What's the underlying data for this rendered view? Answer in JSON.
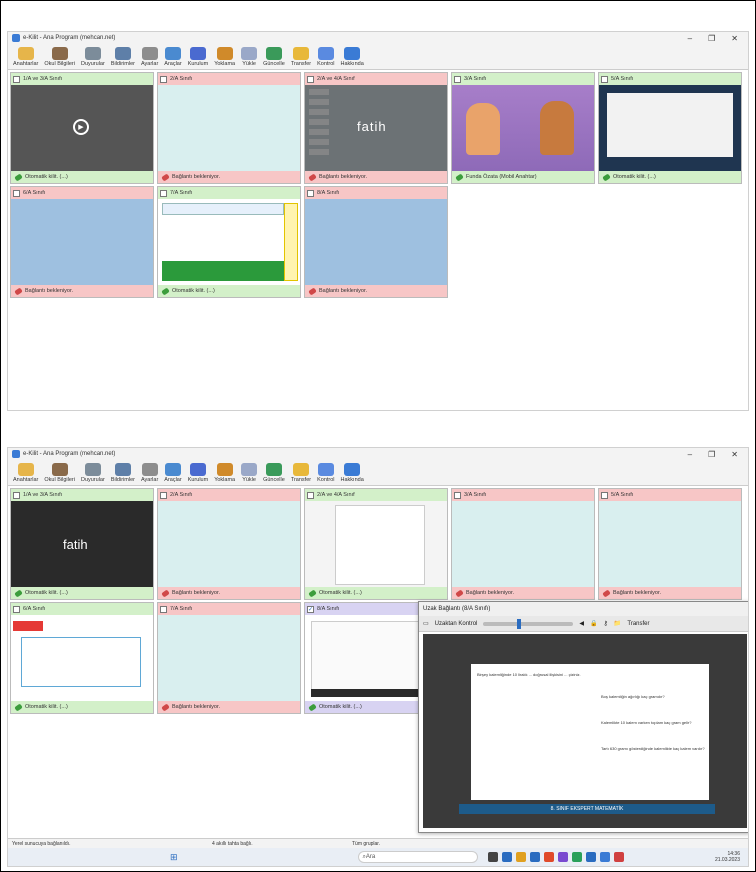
{
  "app": {
    "title": "e-Kilit - Ana Program (mehcan.net)"
  },
  "toolbar": [
    {
      "label": "Anahtarlar",
      "color": "#e6b54a"
    },
    {
      "label": "Okul Bilgileri",
      "color": "#8a6a4a"
    },
    {
      "label": "Duyurular",
      "color": "#7c8c9a"
    },
    {
      "label": "Bildirimler",
      "color": "#5e7fa8"
    },
    {
      "label": "Ayarlar",
      "color": "#8d8d8d"
    },
    {
      "label": "Araçlar",
      "color": "#4a8ad0"
    },
    {
      "label": "Kurulum",
      "color": "#4a6ad0"
    },
    {
      "label": "Yoklama",
      "color": "#d08a2a"
    },
    {
      "label": "Yükle",
      "color": "#9aa8c8"
    },
    {
      "label": "Güncelle",
      "color": "#3a9a5a"
    },
    {
      "label": "Transfer",
      "color": "#e8b83a"
    },
    {
      "label": "Kontrol",
      "color": "#5a8ae0"
    },
    {
      "label": "Hakkında",
      "color": "#3a7bd5"
    }
  ],
  "top": {
    "tiles": [
      {
        "name": "1/A ve 3/A Sınıfı",
        "status": "Otomatik kilit. (...)",
        "state": "green",
        "preview": "video",
        "checked": false
      },
      {
        "name": "2/A Sınıfı",
        "status": "Bağlantı bekleniyor.",
        "state": "red",
        "preview": "empty",
        "checked": false
      },
      {
        "name": "2/A ve 4/A Sınıf",
        "status": "Bağlantı bekleniyor.",
        "state": "red",
        "preview": "desk",
        "checked": false
      },
      {
        "name": "3/A Sınıfı",
        "status": "Funda Özata (Mobil Anahtar)",
        "state": "green",
        "preview": "cartoon",
        "checked": false
      },
      {
        "name": "5/A Sınıfı",
        "status": "Otomatik kilit. (...)",
        "state": "green",
        "preview": "win",
        "checked": false
      },
      {
        "name": "6/A Sınıfı",
        "status": "Bağlantı bekleniyor.",
        "state": "red",
        "preview": "blue",
        "checked": false
      },
      {
        "name": "7/A Sınıfı",
        "status": "Otomatik kilit. (...)",
        "state": "green",
        "preview": "quiz",
        "checked": false
      },
      {
        "name": "8/A Sınıfı",
        "status": "Bağlantı bekleniyor.",
        "state": "red",
        "preview": "blue",
        "checked": false
      }
    ]
  },
  "bottom": {
    "tiles": [
      {
        "name": "1/A ve 3/A Sınıfı",
        "status": "Otomatik kilit. (...)",
        "state": "green",
        "preview": "dark",
        "checked": false
      },
      {
        "name": "2/A Sınıfı",
        "status": "Bağlantı bekleniyor.",
        "state": "red",
        "preview": "empty",
        "checked": false
      },
      {
        "name": "2/A ve 4/A Sınıf",
        "status": "Otomatik kilit. (...)",
        "state": "green",
        "preview": "doc",
        "checked": false
      },
      {
        "name": "3/A Sınıfı",
        "status": "Bağlantı bekleniyor.",
        "state": "red",
        "preview": "empty",
        "checked": false
      },
      {
        "name": "5/A Sınıfı",
        "status": "Bağlantı bekleniyor.",
        "state": "red",
        "preview": "empty",
        "checked": false
      },
      {
        "name": "6/A Sınıfı",
        "status": "Otomatik kilit. (...)",
        "state": "green",
        "preview": "redbox",
        "checked": false
      },
      {
        "name": "7/A Sınıfı",
        "status": "Bağlantı bekleniyor.",
        "state": "red",
        "preview": "empty",
        "checked": false
      },
      {
        "name": "8/A Sınıfı",
        "status": "Otomatik kilit. (...)",
        "state": "purple",
        "preview": "small",
        "checked": true
      }
    ],
    "remote": {
      "title": "Uzak Bağlantı (8/A Sınıfı)",
      "control_label": "Uzaktan Kontrol",
      "transfer_label": "Transfer",
      "q1": "Birşey kalemliğinde 10 liralık ... doğrusal ilişkisini ... çiziniz.",
      "q2": "Boş kalemliğin ağırlığı kaç gramdır?",
      "q3": "Kalemlikte 10 kalem varken toplam kaç gram gelir?",
      "q4": "Tartı 630 gramı gösterdiğinde kalemlikte kaç kalem vardır?",
      "banner": "8. SINIF EKSPERT MATEMATİK"
    },
    "status": {
      "server": "Yerel sunucuya bağlanıldı.",
      "keys": "4 akıllı tahta bağlı.",
      "groups": "Tüm gruplar."
    },
    "taskbar": {
      "search": "Ara",
      "time": "14:36",
      "date": "21.03.2023"
    }
  }
}
